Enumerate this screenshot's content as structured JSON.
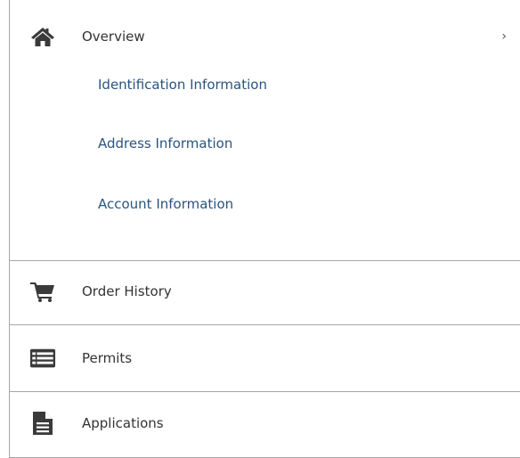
{
  "overview": {
    "label": "Overview",
    "chevron": "›",
    "icon": "home-icon",
    "children": [
      {
        "label": "Identification Information"
      },
      {
        "label": "Address Information"
      },
      {
        "label": "Account Information"
      }
    ]
  },
  "items": [
    {
      "label": "Order History",
      "icon": "cart-icon"
    },
    {
      "label": "Permits",
      "icon": "list-icon"
    },
    {
      "label": "Applications",
      "icon": "document-icon"
    }
  ],
  "colors": {
    "icon": "#3a3a3a",
    "link": "#2a5480",
    "divider": "#a6a6a6"
  }
}
